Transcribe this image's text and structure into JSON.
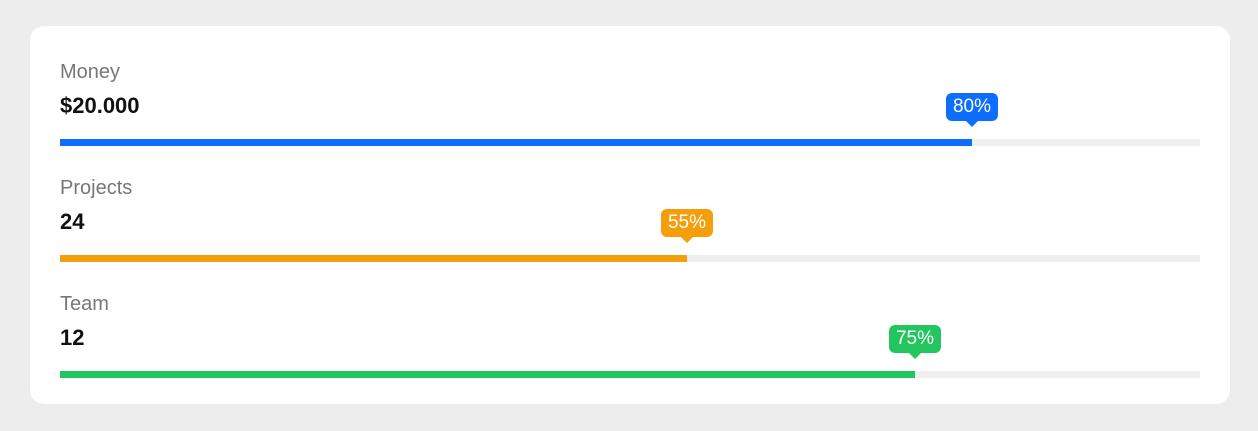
{
  "metrics": [
    {
      "label": "Money",
      "value": "$20.000",
      "percent_label": "80%",
      "percent": 80,
      "color": "#0d6efd"
    },
    {
      "label": "Projects",
      "value": "24",
      "percent_label": "55%",
      "percent": 55,
      "color": "#f59e0b"
    },
    {
      "label": "Team",
      "value": "12",
      "percent_label": "75%",
      "percent": 75,
      "color": "#22c55e"
    }
  ]
}
